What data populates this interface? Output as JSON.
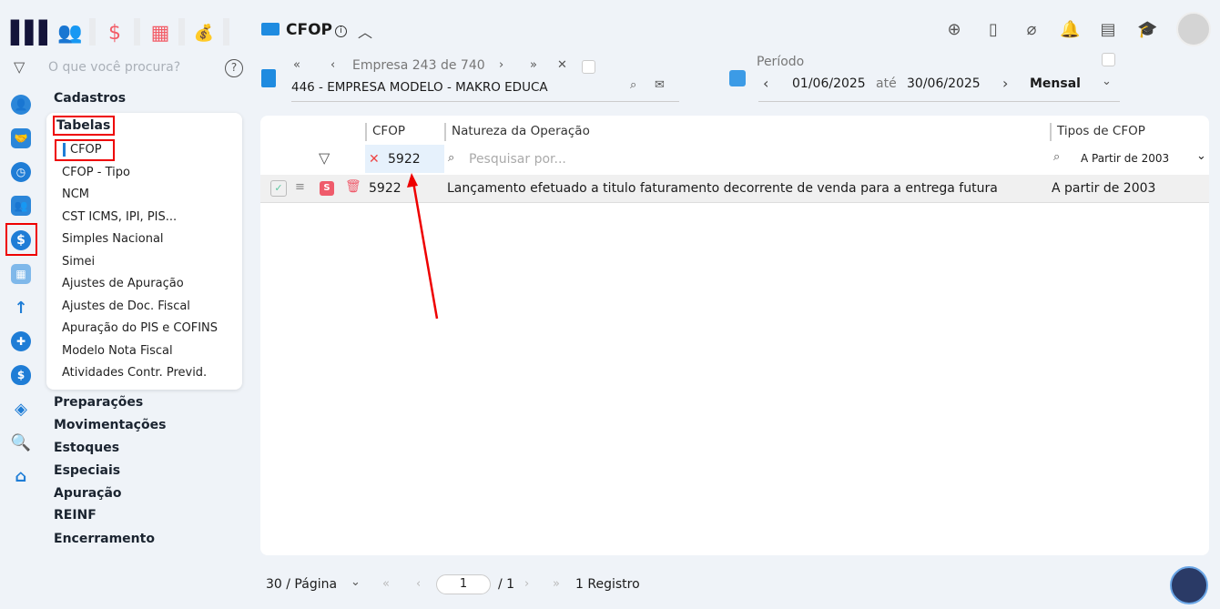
{
  "app": {
    "search_placeholder": "O que você procura?",
    "help": "?"
  },
  "menu": {
    "cadastros": "Cadastros",
    "tabelas": "Tabelas",
    "items": [
      "CFOP",
      "CFOP - Tipo",
      "NCM",
      "CST ICMS, IPI, PIS...",
      "Simples Nacional",
      "Simei",
      "Ajustes de Apuração",
      "Ajustes de Doc. Fiscal",
      "Apuração do PIS e COFINS",
      "Modelo Nota Fiscal",
      "Atividades Contr. Previd."
    ],
    "sections": [
      "Preparações",
      "Movimentações",
      "Estoques",
      "Especiais",
      "Apuração",
      "REINF",
      "Encerramento"
    ]
  },
  "page": {
    "title": "CFOP"
  },
  "empresa": {
    "nav_label": "Empresa",
    "current": "243",
    "of": "de",
    "total": "740",
    "name": "446 - EMPRESA MODELO  - MAKRO EDUCA"
  },
  "periodo": {
    "label": "Período",
    "start": "01/06/2025",
    "until": "até",
    "end": "30/06/2025",
    "mode": "Mensal"
  },
  "table": {
    "columns": [
      "CFOP",
      "Natureza da Operação",
      "Tipos de CFOP"
    ],
    "filter": {
      "cfop": "5922",
      "search_placeholder": "Pesquisar por...",
      "tipo": "A Partir de 2003"
    },
    "rows": [
      {
        "badge": "S",
        "cfop": "5922",
        "natureza": "Lançamento efetuado a titulo faturamento decorrente de venda para a entrega futura",
        "tipo": "A partir de 2003"
      }
    ]
  },
  "pager": {
    "per_page": "30 / Página",
    "page": "1",
    "of_pages": "/ 1",
    "records": "1 Registro"
  }
}
